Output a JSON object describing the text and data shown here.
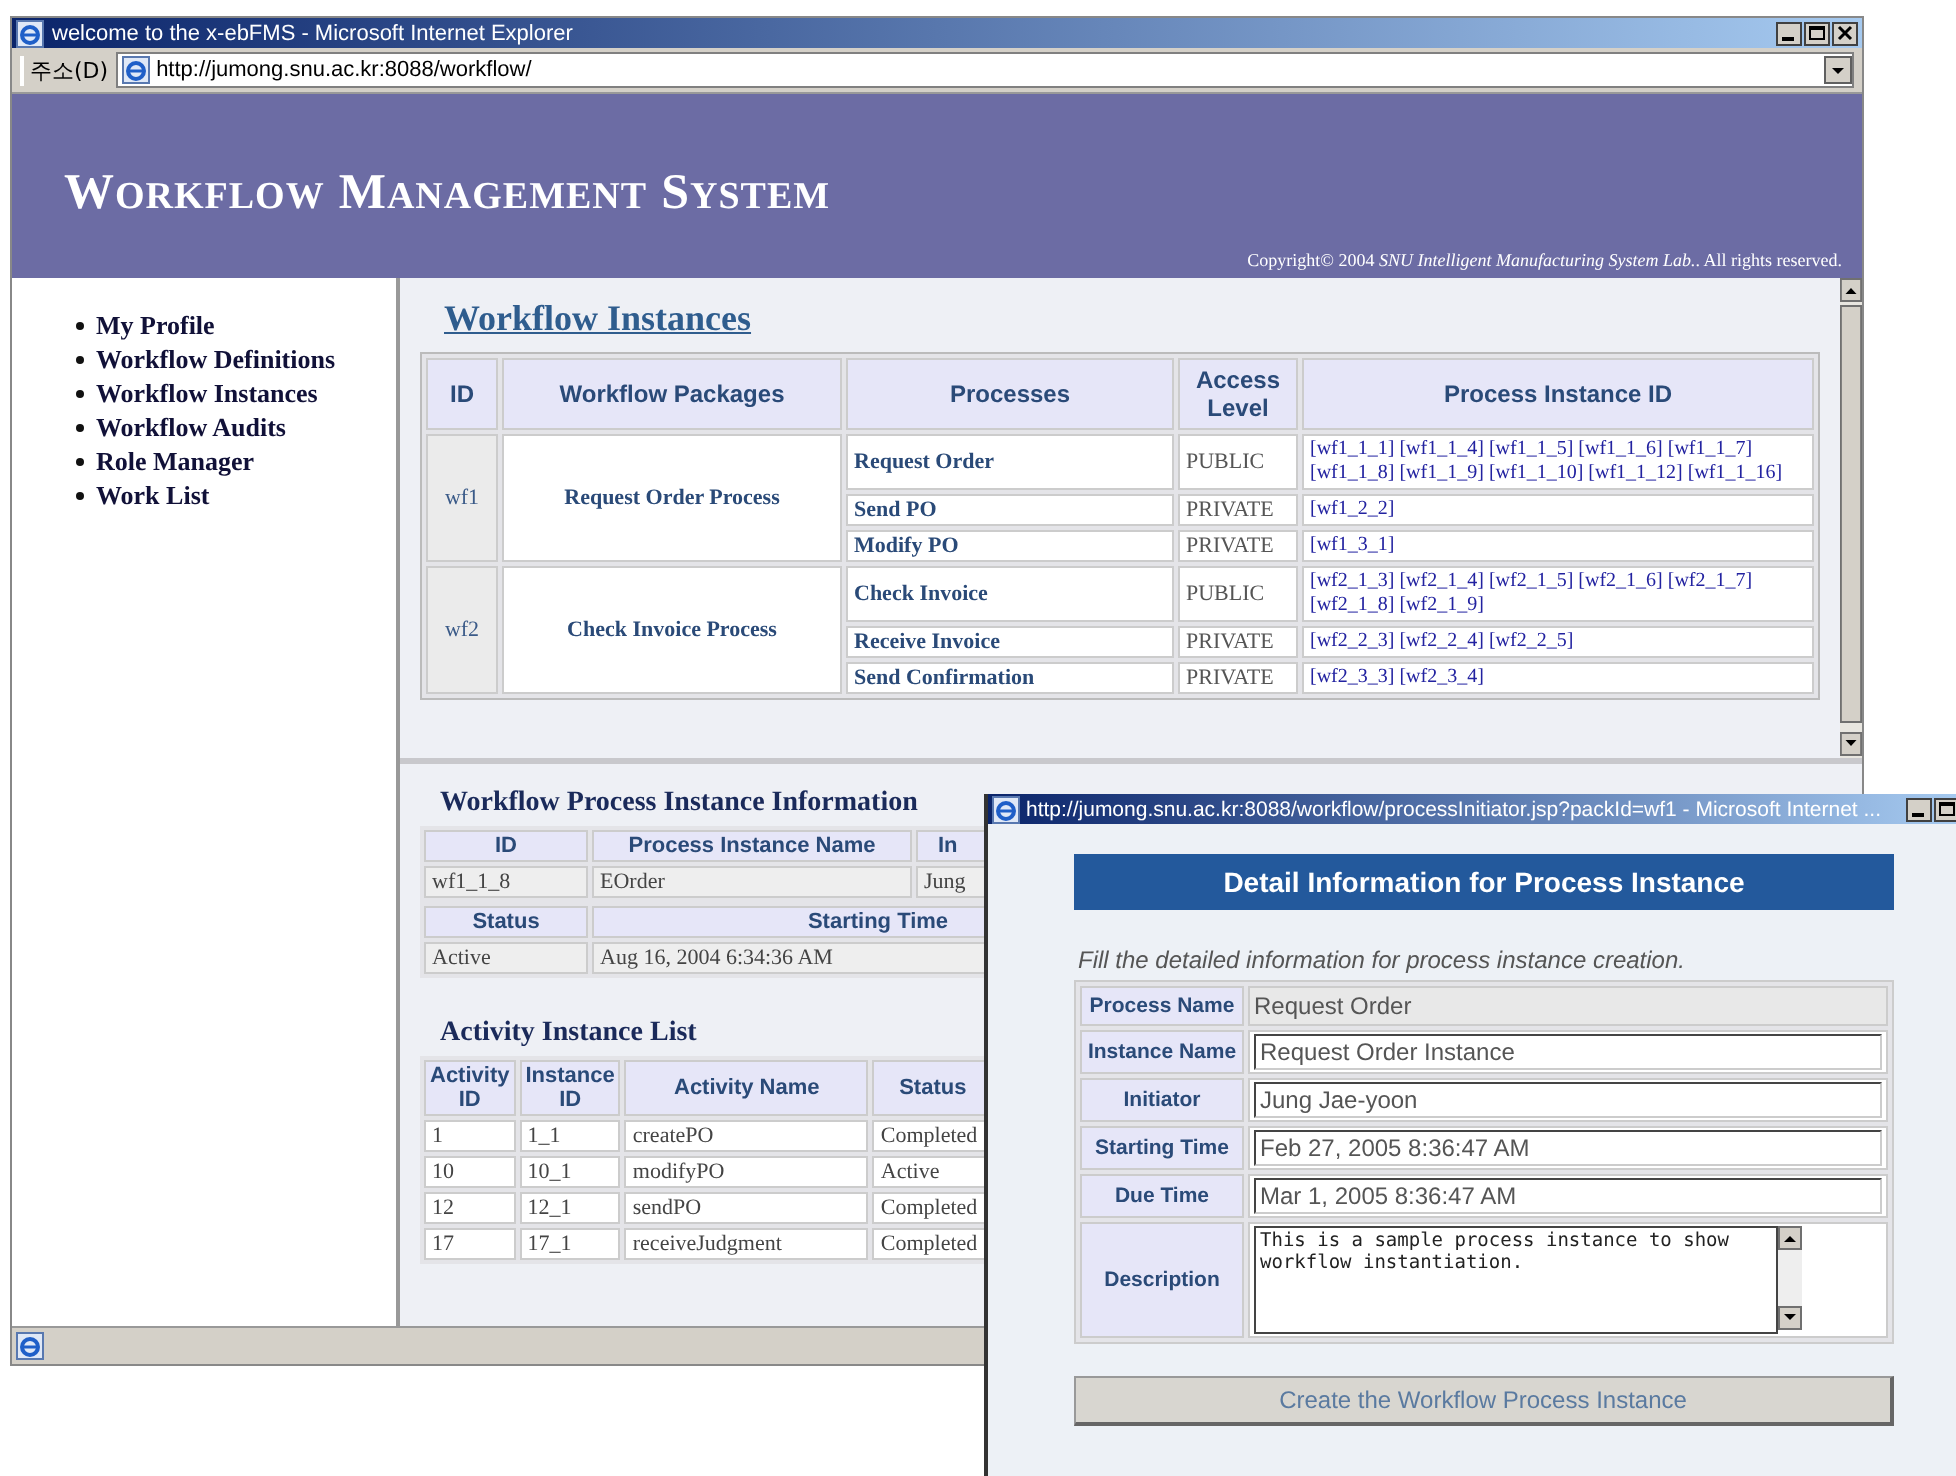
{
  "main_window": {
    "title": "welcome to the x-ebFMS - Microsoft Internet Explorer"
  },
  "address_bar": {
    "label": "주소(D)",
    "url": "http://jumong.snu.ac.kr:8088/workflow/"
  },
  "banner": {
    "title": "WORKFLOW MANAGEMENT SYSTEM",
    "copyright": "Copyright© 2004 *SNU Intelligent Manufacturing System Lab.*. All rights reserved."
  },
  "sidebar": {
    "items": [
      "My Profile",
      "Workflow Definitions",
      "Workflow Instances",
      "Workflow Audits",
      "Role Manager",
      "Work List"
    ]
  },
  "instances": {
    "title": "Workflow Instances",
    "columns": [
      "ID",
      "Workflow Packages",
      "Processes",
      "Access Level",
      "Process Instance ID"
    ],
    "groups": [
      {
        "id": "wf1",
        "package": "Request Order Process",
        "processes": [
          {
            "name": "Request Order",
            "access": "PUBLIC",
            "instances": [
              "[wf1_1_1]",
              "[wf1_1_4]",
              "[wf1_1_5]",
              "[wf1_1_6]",
              "[wf1_1_7]",
              "[wf1_1_8]",
              "[wf1_1_9]",
              "[wf1_1_10]",
              "[wf1_1_12]",
              "[wf1_1_16]"
            ]
          },
          {
            "name": "Send PO",
            "access": "PRIVATE",
            "instances": [
              "[wf1_2_2]"
            ]
          },
          {
            "name": "Modify PO",
            "access": "PRIVATE",
            "instances": [
              "[wf1_3_1]"
            ]
          }
        ]
      },
      {
        "id": "wf2",
        "package": "Check Invoice Process",
        "processes": [
          {
            "name": "Check Invoice",
            "access": "PUBLIC",
            "instances": [
              "[wf2_1_3]",
              "[wf2_1_4]",
              "[wf2_1_5]",
              "[wf2_1_6]",
              "[wf2_1_7]",
              "[wf2_1_8]",
              "[wf2_1_9]"
            ]
          },
          {
            "name": "Receive Invoice",
            "access": "PRIVATE",
            "instances": [
              "[wf2_2_3]",
              "[wf2_2_4]",
              "[wf2_2_5]"
            ]
          },
          {
            "name": "Send Confirmation",
            "access": "PRIVATE",
            "instances": [
              "[wf2_3_3]",
              "[wf2_3_4]"
            ]
          }
        ]
      }
    ]
  },
  "process_info": {
    "title": "Workflow Process Instance Information",
    "table_1": {
      "columns": [
        "ID",
        "Process Instance Name",
        "In"
      ],
      "row": [
        "wf1_1_8",
        "EOrder",
        "Jung"
      ]
    },
    "table_2": {
      "columns": [
        "Status",
        "Starting Time"
      ],
      "row": [
        "Active",
        "Aug 16, 2004 6:34:36 AM"
      ]
    }
  },
  "activity_list": {
    "title": "Activity Instance List",
    "columns": [
      "Activity ID",
      "Instance ID",
      "Activity Name",
      "Status"
    ],
    "rows": [
      [
        "1",
        "1_1",
        "createPO",
        "Completed"
      ],
      [
        "10",
        "10_1",
        "modifyPO",
        "Active"
      ],
      [
        "12",
        "12_1",
        "sendPO",
        "Completed"
      ],
      [
        "17",
        "17_1",
        "receiveJudgment",
        "Completed"
      ]
    ]
  },
  "popup": {
    "title": "http://jumong.snu.ac.kr:8088/workflow/processInitiator.jsp?packId=wf1 - Microsoft Internet ...",
    "heading": "Detail Information for Process Instance",
    "hint": "Fill the detailed information for process instance creation.",
    "fields": [
      {
        "label": "Process Name",
        "value": "Request Order",
        "kind": "readonly"
      },
      {
        "label": "Instance Name",
        "value": "Request Order Instance",
        "kind": "input"
      },
      {
        "label": "Initiator",
        "value": "Jung Jae-yoon",
        "kind": "input"
      },
      {
        "label": "Starting Time",
        "value": "Feb 27, 2005 8:36:47 AM",
        "kind": "input"
      },
      {
        "label": "Due Time",
        "value": "Mar 1, 2005 8:36:47 AM",
        "kind": "input"
      },
      {
        "label": "Description",
        "value": "This is a sample process instance to show workflow instantiation.",
        "kind": "textarea"
      }
    ],
    "button": "Create the Workflow Process Instance"
  }
}
